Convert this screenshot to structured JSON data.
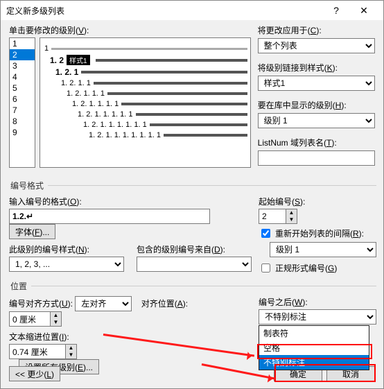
{
  "title": "定义新多级列表",
  "top": {
    "levels_label": "单击要修改的级别(",
    "levels_key": "V",
    "levels_label_end": "):",
    "levels": [
      "1",
      "2",
      "3",
      "4",
      "5",
      "6",
      "7",
      "8",
      "9"
    ],
    "selected_level": "2",
    "apply_label": "将更改应用于(",
    "apply_key": "C",
    "apply_end": "):",
    "apply_value": "整个列表",
    "link_label": "将级别链接到样式(",
    "link_key": "K",
    "link_end": "):",
    "link_value": "样式1",
    "showlib_label": "要在库中显示的级别(",
    "showlib_key": "H",
    "showlib_end": "):",
    "showlib_value": "级别 1",
    "listnum_label": "ListNum 域列表名(",
    "listnum_key": "T",
    "listnum_end": "):",
    "listnum_value": "",
    "preview_style1": "样式1",
    "preview_lines": [
      {
        "n": "1",
        "cls": "head"
      },
      {
        "n": "1. 2",
        "cls": "bold",
        "sty": true
      },
      {
        "n": "1. 2. 1",
        "cls": "bold"
      },
      {
        "n": "1. 2. 1. 1",
        "cls": ""
      },
      {
        "n": "1. 2. 1. 1. 1",
        "cls": ""
      },
      {
        "n": "1. 2. 1. 1. 1. 1",
        "cls": ""
      },
      {
        "n": "1. 2. 1. 1. 1. 1. 1",
        "cls": ""
      },
      {
        "n": "1. 2. 1. 1. 1. 1. 1. 1",
        "cls": ""
      },
      {
        "n": "1. 2. 1. 1. 1. 1. 1. 1. 1",
        "cls": ""
      }
    ]
  },
  "numfmt": {
    "legend": "编号格式",
    "format_label": "输入编号的格式(",
    "format_key": "O",
    "format_end": "):",
    "format_value": "1.2.↵",
    "font_btn": "字体(",
    "font_key": "F",
    "font_end": ")...",
    "style_label": "此级别的编号样式(",
    "style_key": "N",
    "style_end": "):",
    "style_value": "1, 2, 3, ...",
    "include_label": "包含的级别编号来自(",
    "include_key": "D",
    "include_end": "):",
    "start_label": "起始编号(",
    "start_key": "S",
    "start_end": "):",
    "start_value": "2",
    "restart_label": "重新开始列表的间隔(",
    "restart_key": "R",
    "restart_end": "):",
    "restart_checked": true,
    "restart_value": "级别 1",
    "legal_label": "正规形式编号(",
    "legal_key": "G",
    "legal_end": ")",
    "legal_checked": false
  },
  "pos": {
    "legend": "位置",
    "align_label": "编号对齐方式(",
    "align_key": "U",
    "align_end": "):",
    "align_value": "左对齐",
    "alignat_label": "对齐位置(",
    "alignat_key": "A",
    "alignat_end": "):",
    "alignat_value": "0 厘米",
    "indent_label": "文本缩进位置(",
    "indent_key": "I",
    "indent_end": "):",
    "indent_value": "0.74 厘米",
    "setall_btn": "设置所有级别(",
    "setall_key": "E",
    "setall_end": ")...",
    "after_label": "编号之后(",
    "after_key": "W",
    "after_end": "):",
    "after_value": "不特别标注",
    "after_options": [
      "制表符",
      "空格",
      "不特别标注"
    ]
  },
  "footer": {
    "less": "<< 更少(",
    "less_key": "L",
    "less_end": ")",
    "ok": "确定",
    "cancel": "取消"
  }
}
